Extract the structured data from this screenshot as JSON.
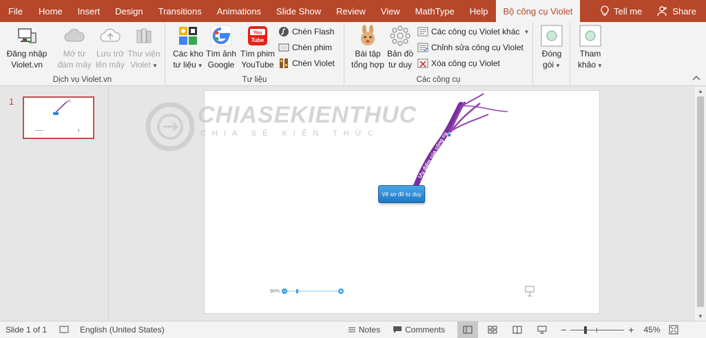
{
  "tabs": [
    {
      "label": "File"
    },
    {
      "label": "Home"
    },
    {
      "label": "Insert"
    },
    {
      "label": "Design"
    },
    {
      "label": "Transitions"
    },
    {
      "label": "Animations"
    },
    {
      "label": "Slide Show"
    },
    {
      "label": "Review"
    },
    {
      "label": "View"
    },
    {
      "label": "MathType"
    },
    {
      "label": "Help"
    },
    {
      "label": "Bộ công cụ Violet",
      "active": true
    }
  ],
  "tell_me": "Tell me",
  "share": "Share",
  "groups": {
    "violet_services": {
      "label": "Dịch vụ Violet.vn",
      "login": [
        "Đăng nhập",
        "Violet.vn"
      ],
      "open_cloud": [
        "Mở từ",
        "đám mây"
      ],
      "save_cloud": [
        "Lưu trữ",
        "lên mây"
      ],
      "library": [
        "Thư viện",
        "Violet"
      ]
    },
    "resources": {
      "label": "Tư liệu",
      "repositories": [
        "Các kho",
        "tư liệu"
      ],
      "google_images": [
        "Tìm ảnh",
        "Google"
      ],
      "youtube": [
        "Tìm phim",
        "YouTube"
      ],
      "insert_flash": "Chèn Flash",
      "insert_movie": "Chèn phim",
      "insert_violet": "Chèn Violet"
    },
    "tools": {
      "label": "Các công cụ",
      "exercises": [
        "Bài tập",
        "tổng hợp"
      ],
      "mindmap": [
        "Bản đồ",
        "tư duy"
      ],
      "other_tools": "Các công cụ Violet khác",
      "edit_tools": "Chỉnh sửa công cụ Violet",
      "delete_tools": "Xóa công cụ Violet"
    },
    "package": {
      "label": [
        "Đóng",
        "gói"
      ]
    },
    "reference": {
      "label": [
        "Tham",
        "khảo"
      ]
    }
  },
  "slides": {
    "current_number": "1"
  },
  "slide_content": {
    "node_label": "Vẽ sơ đồ tư duy",
    "branch_label": "Ưu điểm của công cụ",
    "zoom_percent": "90%",
    "watermark_text": "CHIASEKIENTHUC",
    "watermark_sub": "CHIA SẺ KIẾN THỨC"
  },
  "status": {
    "slide_info": "Slide 1 of 1",
    "language": "English (United States)",
    "notes": "Notes",
    "comments": "Comments",
    "zoom": "45%"
  },
  "colors": {
    "accent": "#b7472a",
    "mindmap_branch": "#7b2c9e",
    "node": "#2b8ad8"
  }
}
